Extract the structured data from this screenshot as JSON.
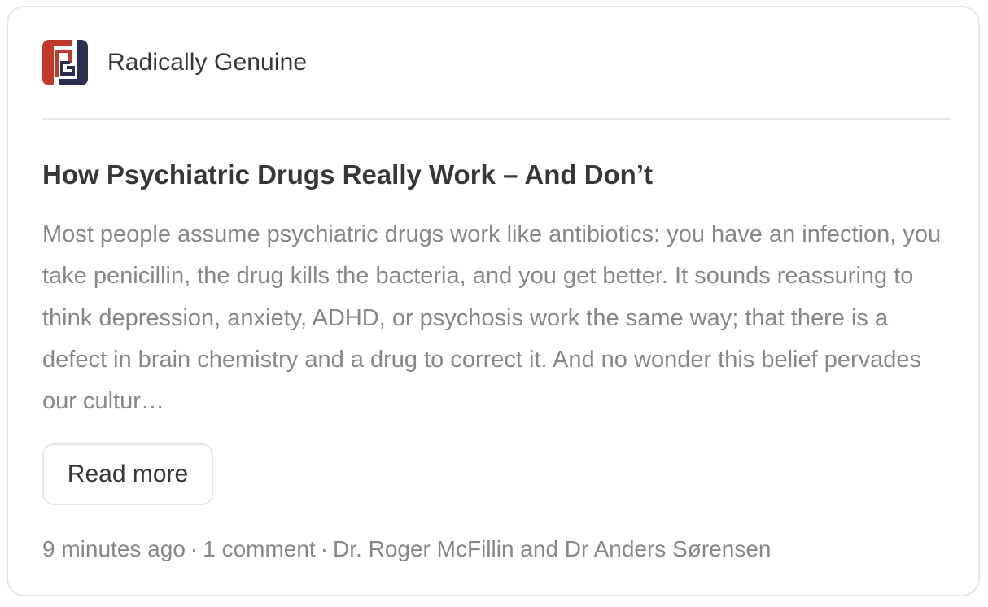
{
  "publication": {
    "name": "Radically Genuine",
    "logo_icon": "radically-genuine-logo"
  },
  "post": {
    "title": "How Psychiatric Drugs Really Work – And Don’t",
    "excerpt": "Most people assume psychiatric drugs work like antibiotics: you have an infection, you take penicillin, the drug kills the bacteria, and you get better. It sounds reassuring to think depression, anxiety, ADHD, or psychosis work the same way; that there is a defect in brain chemistry and a drug to correct it. And no wonder this belief pervades our cultur…",
    "read_more_label": "Read more"
  },
  "meta": {
    "time_ago": "9 minutes ago",
    "comments": "1 comment",
    "authors": "Dr. Roger McFillin and Dr Anders Sørensen",
    "separator": "·"
  },
  "colors": {
    "logo_red": "#c0392b",
    "logo_navy": "#2a2f4f",
    "text_primary": "#363737",
    "text_secondary": "#868787",
    "border": "#e6e6e6"
  }
}
